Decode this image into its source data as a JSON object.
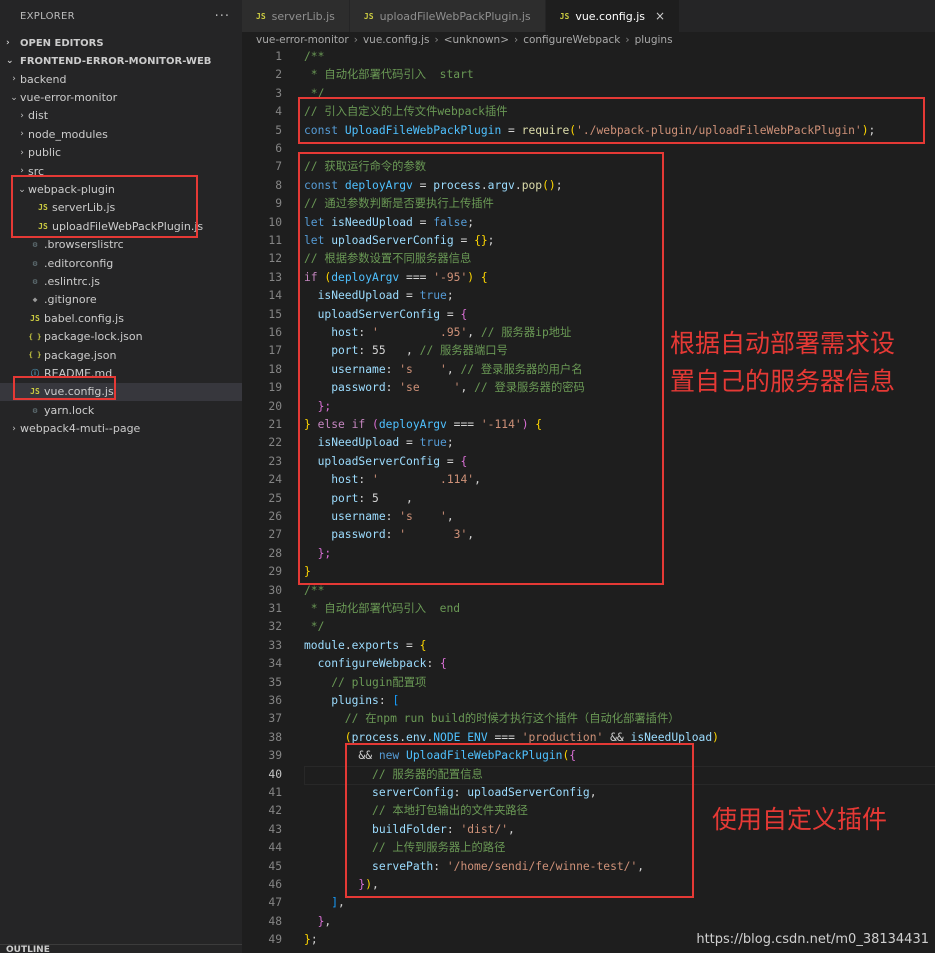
{
  "explorer": {
    "title": "EXPLORER",
    "more_icon": "ellipsis-icon",
    "open_editors_label": "OPEN EDITORS",
    "project_label": "FRONTEND-ERROR-MONITOR-WEB",
    "outline_label": "OUTLINE",
    "tree": [
      {
        "label": "backend",
        "indent": 1,
        "type": "folder",
        "expanded": false
      },
      {
        "label": "vue-error-monitor",
        "indent": 1,
        "type": "folder",
        "expanded": true
      },
      {
        "label": "dist",
        "indent": 2,
        "type": "folder",
        "expanded": false
      },
      {
        "label": "node_modules",
        "indent": 2,
        "type": "folder",
        "expanded": false
      },
      {
        "label": "public",
        "indent": 2,
        "type": "folder",
        "expanded": false
      },
      {
        "label": "src",
        "indent": 2,
        "type": "folder",
        "expanded": false
      },
      {
        "label": "webpack-plugin",
        "indent": 2,
        "type": "folder",
        "expanded": true
      },
      {
        "label": "serverLib.js",
        "indent": 3,
        "type": "js"
      },
      {
        "label": "uploadFileWebPackPlugin.js",
        "indent": 3,
        "type": "js"
      },
      {
        "label": ".browserslistrc",
        "indent": 2,
        "type": "cfg"
      },
      {
        "label": ".editorconfig",
        "indent": 2,
        "type": "cfg"
      },
      {
        "label": ".eslintrc.js",
        "indent": 2,
        "type": "cfg"
      },
      {
        "label": ".gitignore",
        "indent": 2,
        "type": "git"
      },
      {
        "label": "babel.config.js",
        "indent": 2,
        "type": "js"
      },
      {
        "label": "package-lock.json",
        "indent": 2,
        "type": "json"
      },
      {
        "label": "package.json",
        "indent": 2,
        "type": "json"
      },
      {
        "label": "README.md",
        "indent": 2,
        "type": "info"
      },
      {
        "label": "vue.config.js",
        "indent": 2,
        "type": "js",
        "active": true
      },
      {
        "label": "yarn.lock",
        "indent": 2,
        "type": "cfg"
      },
      {
        "label": "webpack4-muti--page",
        "indent": 1,
        "type": "folder",
        "expanded": false
      }
    ]
  },
  "tabs": [
    {
      "label": "serverLib.js",
      "active": false
    },
    {
      "label": "uploadFileWebPackPlugin.js",
      "active": false
    },
    {
      "label": "vue.config.js",
      "active": true
    }
  ],
  "breadcrumb": [
    "vue-error-monitor",
    "vue.config.js",
    "<unknown>",
    "configureWebpack",
    "plugins"
  ],
  "editor": {
    "current_line": 40,
    "lines": [
      [
        [
          "/**",
          "com"
        ]
      ],
      [
        [
          " * 自动化部署代码引入  start",
          "com"
        ]
      ],
      [
        [
          " */",
          "com"
        ]
      ],
      [
        [
          "// 引入自定义的上传文件webpack插件",
          "com"
        ]
      ],
      [
        [
          "const ",
          "kw"
        ],
        [
          "UploadFileWebPackPlugin",
          "const"
        ],
        [
          " = ",
          "p"
        ],
        [
          "require",
          "fn"
        ],
        [
          "(",
          "br1"
        ],
        [
          "'./webpack-plugin/uploadFileWebPackPlugin'",
          "str"
        ],
        [
          ")",
          "br1"
        ],
        [
          ";",
          "p"
        ]
      ],
      [],
      [
        [
          "// 获取运行命令的参数",
          "com"
        ]
      ],
      [
        [
          "const ",
          "kw"
        ],
        [
          "deployArgv",
          "const"
        ],
        [
          " = ",
          "p"
        ],
        [
          "process",
          "var"
        ],
        [
          ".",
          "p"
        ],
        [
          "argv",
          "var"
        ],
        [
          ".",
          "p"
        ],
        [
          "pop",
          "fn"
        ],
        [
          "()",
          "br1"
        ],
        [
          ";",
          "p"
        ]
      ],
      [
        [
          "// 通过参数判断是否要执行上传插件",
          "com"
        ]
      ],
      [
        [
          "let ",
          "kw"
        ],
        [
          "isNeedUpload",
          "var"
        ],
        [
          " = ",
          "p"
        ],
        [
          "false",
          "kw"
        ],
        [
          ";",
          "p"
        ]
      ],
      [
        [
          "let ",
          "kw"
        ],
        [
          "uploadServerConfig",
          "var"
        ],
        [
          " = ",
          "p"
        ],
        [
          "{}",
          "br1"
        ],
        [
          ";",
          "p"
        ]
      ],
      [
        [
          "// 根据参数设置不同服务器信息",
          "com"
        ]
      ],
      [
        [
          "if ",
          "ctl"
        ],
        [
          "(",
          "br1"
        ],
        [
          "deployArgv",
          "const"
        ],
        [
          " === ",
          "p"
        ],
        [
          "'-95'",
          "str"
        ],
        [
          ") ",
          "br1"
        ],
        [
          "{",
          "br1"
        ]
      ],
      [
        [
          "  isNeedUpload",
          "var"
        ],
        [
          " = ",
          "p"
        ],
        [
          "true",
          "kw"
        ],
        [
          ";",
          "p"
        ]
      ],
      [
        [
          "  uploadServerConfig",
          "var"
        ],
        [
          " = ",
          "p"
        ],
        [
          "{",
          "br2"
        ]
      ],
      [
        [
          "    host",
          "var"
        ],
        [
          ": ",
          "p"
        ],
        [
          "'         .95'",
          "str"
        ],
        [
          ", ",
          "p"
        ],
        [
          "// 服务器ip地址",
          "com"
        ]
      ],
      [
        [
          "    port",
          "var"
        ],
        [
          ": ",
          "p"
        ],
        [
          "55   ",
          "p"
        ],
        [
          ", ",
          "p"
        ],
        [
          "// 服务器端口号",
          "com"
        ]
      ],
      [
        [
          "    username",
          "var"
        ],
        [
          ": ",
          "p"
        ],
        [
          "'s    '",
          "str"
        ],
        [
          ", ",
          "p"
        ],
        [
          "// 登录服务器的用户名",
          "com"
        ]
      ],
      [
        [
          "    password",
          "var"
        ],
        [
          ": ",
          "p"
        ],
        [
          "'se     '",
          "str"
        ],
        [
          ", ",
          "p"
        ],
        [
          "// 登录服务器的密码",
          "com"
        ]
      ],
      [
        [
          "  };",
          "br2"
        ]
      ],
      [
        [
          "} ",
          "br1"
        ],
        [
          "else if ",
          "ctl"
        ],
        [
          "(",
          "br2"
        ],
        [
          "deployArgv",
          "const"
        ],
        [
          " === ",
          "p"
        ],
        [
          "'-114'",
          "str"
        ],
        [
          ") ",
          "br2"
        ],
        [
          "{",
          "br1"
        ]
      ],
      [
        [
          "  isNeedUpload",
          "var"
        ],
        [
          " = ",
          "p"
        ],
        [
          "true",
          "kw"
        ],
        [
          ";",
          "p"
        ]
      ],
      [
        [
          "  uploadServerConfig",
          "var"
        ],
        [
          " = ",
          "p"
        ],
        [
          "{",
          "br2"
        ]
      ],
      [
        [
          "    host",
          "var"
        ],
        [
          ": ",
          "p"
        ],
        [
          "'         .114'",
          "str"
        ],
        [
          ",",
          "p"
        ]
      ],
      [
        [
          "    port",
          "var"
        ],
        [
          ": ",
          "p"
        ],
        [
          "5    ",
          "p"
        ],
        [
          ",",
          "p"
        ]
      ],
      [
        [
          "    username",
          "var"
        ],
        [
          ": ",
          "p"
        ],
        [
          "'s    '",
          "str"
        ],
        [
          ",",
          "p"
        ]
      ],
      [
        [
          "    password",
          "var"
        ],
        [
          ": ",
          "p"
        ],
        [
          "'       3'",
          "str"
        ],
        [
          ",",
          "p"
        ]
      ],
      [
        [
          "  };",
          "br2"
        ]
      ],
      [
        [
          "}",
          "br1"
        ]
      ],
      [
        [
          "/**",
          "com"
        ]
      ],
      [
        [
          " * 自动化部署代码引入  end",
          "com"
        ]
      ],
      [
        [
          " */",
          "com"
        ]
      ],
      [
        [
          "module",
          "var"
        ],
        [
          ".",
          "p"
        ],
        [
          "exports",
          "var"
        ],
        [
          " = ",
          "p"
        ],
        [
          "{",
          "br1"
        ]
      ],
      [
        [
          "  configureWebpack",
          "var"
        ],
        [
          ": ",
          "p"
        ],
        [
          "{",
          "br2"
        ]
      ],
      [
        [
          "    // plugin配置项",
          "com"
        ]
      ],
      [
        [
          "    plugins",
          "var"
        ],
        [
          ": ",
          "p"
        ],
        [
          "[",
          "br3"
        ]
      ],
      [
        [
          "      // 在npm run build的时候才执行这个插件（自动化部署插件）",
          "com"
        ]
      ],
      [
        [
          "      (",
          "br1"
        ],
        [
          "process",
          "var"
        ],
        [
          ".",
          "p"
        ],
        [
          "env",
          "var"
        ],
        [
          ".",
          "p"
        ],
        [
          "NODE_ENV",
          "const"
        ],
        [
          " === ",
          "p"
        ],
        [
          "'production'",
          "str"
        ],
        [
          " && ",
          "p"
        ],
        [
          "isNeedUpload",
          "var"
        ],
        [
          ")",
          "br1"
        ]
      ],
      [
        [
          "        && ",
          "p"
        ],
        [
          "new ",
          "kw"
        ],
        [
          "UploadFileWebPackPlugin",
          "const"
        ],
        [
          "(",
          "br1"
        ],
        [
          "{",
          "br2"
        ]
      ],
      [
        [
          "          // 服务器的配置信息",
          "com"
        ]
      ],
      [
        [
          "          serverConfig",
          "var"
        ],
        [
          ": ",
          "p"
        ],
        [
          "uploadServerConfig",
          "var"
        ],
        [
          ",",
          "p"
        ]
      ],
      [
        [
          "          // 本地打包输出的文件夹路径",
          "com"
        ]
      ],
      [
        [
          "          buildFolder",
          "var"
        ],
        [
          ": ",
          "p"
        ],
        [
          "'dist/'",
          "str"
        ],
        [
          ",",
          "p"
        ]
      ],
      [
        [
          "          // 上传到服务器上的路径",
          "com"
        ]
      ],
      [
        [
          "          servePath",
          "var"
        ],
        [
          ": ",
          "p"
        ],
        [
          "'/home/sendi/fe/winne-test/'",
          "str"
        ],
        [
          ",",
          "p"
        ]
      ],
      [
        [
          "        }",
          "br2"
        ],
        [
          ")",
          "br1"
        ],
        [
          ",",
          "p"
        ]
      ],
      [
        [
          "    ]",
          "br3"
        ],
        [
          ",",
          "p"
        ]
      ],
      [
        [
          "  }",
          "br2"
        ],
        [
          ",",
          "p"
        ]
      ],
      [
        [
          "}",
          "br1"
        ],
        [
          ";",
          "p"
        ]
      ]
    ]
  },
  "annotations": {
    "server_info": "根据自动部署需求设置自己的服务器信息",
    "server_info_line1": "根据自动部署需求设",
    "server_info_line2": "置自己的服务器信息",
    "custom_plugin": "使用自定义插件"
  },
  "watermark": "https://blog.csdn.net/m0_38134431",
  "colors": {
    "annotation_red": "#e53935",
    "editor_bg": "#1e1e1e",
    "sidebar_bg": "#252526"
  }
}
